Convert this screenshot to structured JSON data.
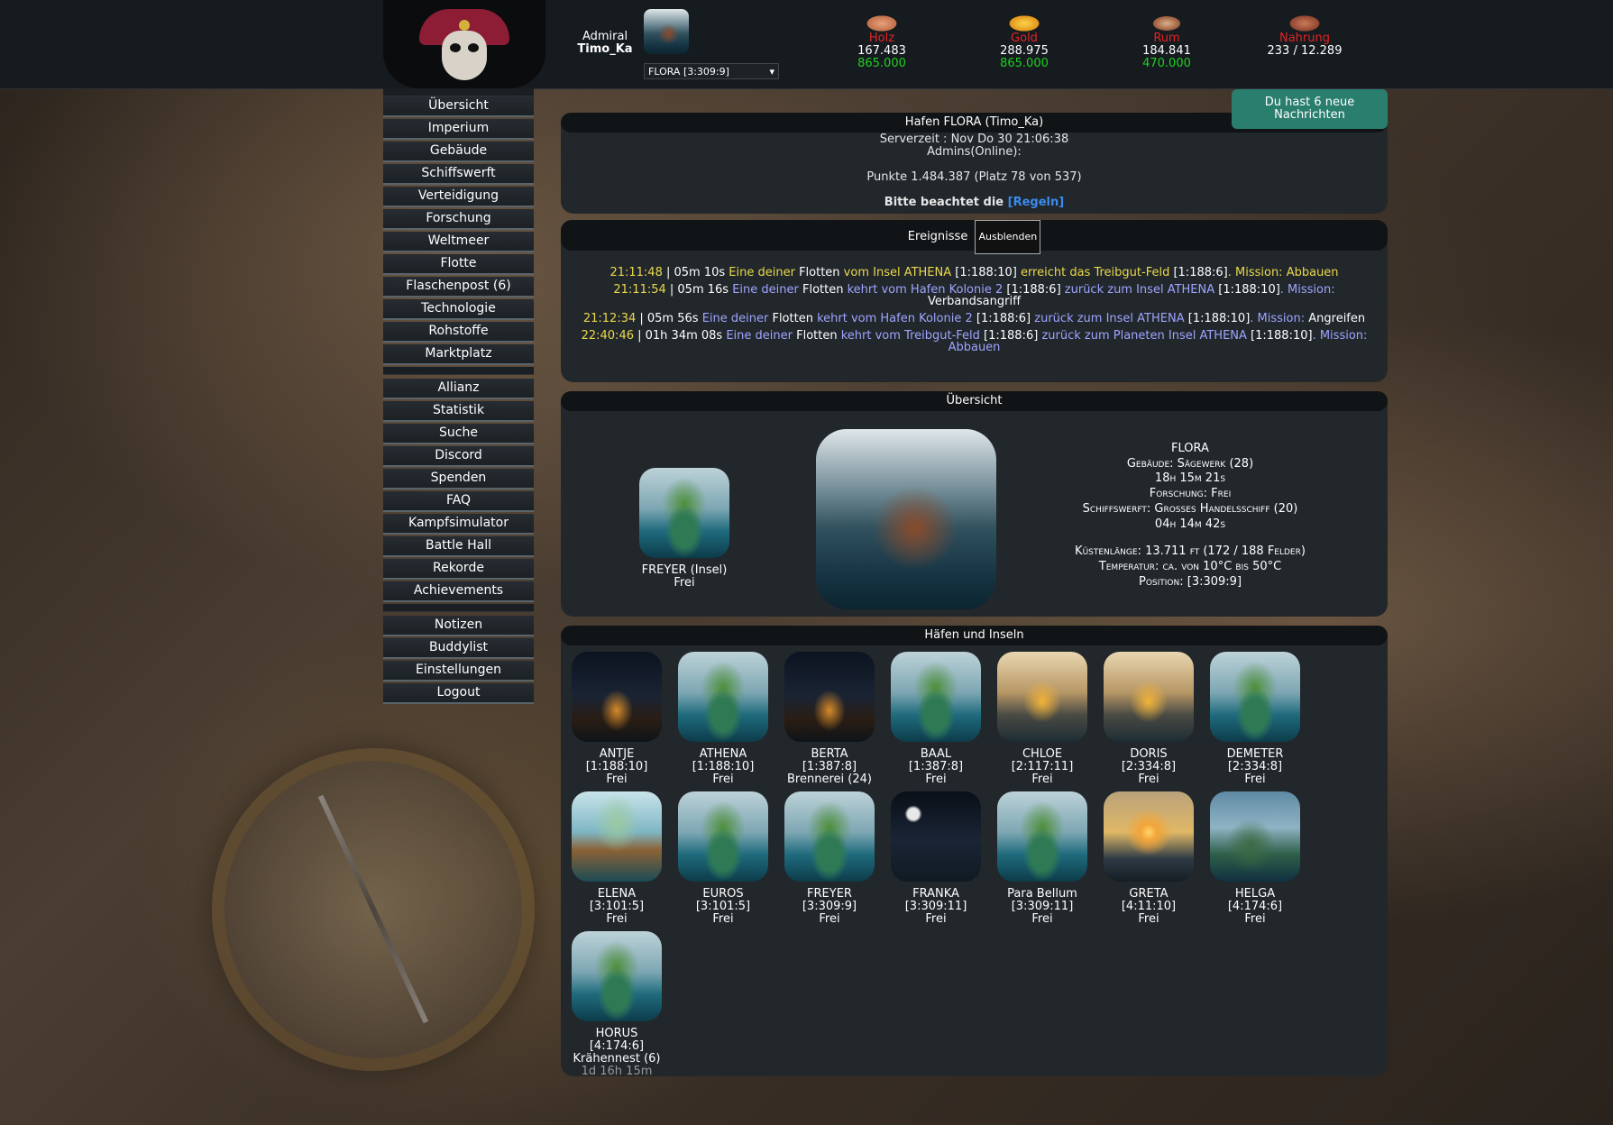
{
  "header": {
    "rank": "Admiral",
    "player": "Timo_Ka",
    "planet_select": "FLORA [3:309:9]",
    "resources": [
      {
        "name": "Holz",
        "current": "167.483",
        "max": "865.000",
        "icon": "wood-icon"
      },
      {
        "name": "Gold",
        "current": "288.975",
        "max": "865.000",
        "icon": "gold-icon"
      },
      {
        "name": "Rum",
        "current": "184.841",
        "max": "470.000",
        "icon": "rum-icon"
      },
      {
        "name": "Nahrung",
        "current": "233 / 12.289",
        "max": "",
        "icon": "food-icon"
      }
    ]
  },
  "sidebar": {
    "group1": [
      "Übersicht",
      "Imperium",
      "Gebäude",
      "Schiffswerft",
      "Verteidigung",
      "Forschung",
      "Weltmeer",
      "Flotte",
      "Flaschenpost (6)",
      "Technologie",
      "Rohstoffe",
      "Marktplatz"
    ],
    "group2": [
      "Allianz",
      "Statistik",
      "Suche",
      "Discord",
      "Spenden",
      "FAQ",
      "Kampfsimulator",
      "Battle Hall",
      "Rekorde",
      "Achievements"
    ],
    "group3": [
      "Notizen",
      "Buddylist",
      "Einstellungen",
      "Logout"
    ]
  },
  "messages": {
    "line1": "Du hast 6 neue",
    "line2": "Nachrichten"
  },
  "harbor": {
    "title": "Hafen FLORA (Timo_Ka)",
    "server_time": "Serverzeit : Nov Do 30 21:06:38",
    "admins": "Admins(Online):",
    "points": "Punkte 1.484.387 (Platz 78 von 537)",
    "rules_prefix": "Bitte beachtet die",
    "rules_link": "[Regeln]"
  },
  "events": {
    "title": "Ereignisse",
    "hide_button": "Ausblenden",
    "items": [
      {
        "time": "21:11:48",
        "dur": " | 05m 10s ",
        "a": "Eine deiner ",
        "b": "Flotten",
        "c": " vom Insel ATHENA ",
        "d": "[1:188:10]",
        "e": " erreicht das Treibgut-Feld ",
        "f": "[1:188:6]",
        "g": ". Mission: ",
        "h": "Abbauen",
        "style": "yellow"
      },
      {
        "time": "21:11:54",
        "dur": " | 05m 16s ",
        "a": "Eine deiner ",
        "b": "Flotten",
        "c": " kehrt vom Hafen Kolonie 2 ",
        "d": "[1:188:6]",
        "e": " zurück zum Insel ATHENA ",
        "f": "[1:188:10]",
        "g": ". Mission: ",
        "h": "Verbandsangriff",
        "style": "lavender"
      },
      {
        "time": "21:12:34",
        "dur": " | 05m 56s ",
        "a": "Eine deiner ",
        "b": "Flotten",
        "c": " kehrt vom Hafen Kolonie 2 ",
        "d": "[1:188:6]",
        "e": " zurück zum Insel ATHENA ",
        "f": "[1:188:10]",
        "g": ". Mission: ",
        "h": "Angreifen",
        "style": "lavender"
      },
      {
        "time": "22:40:46",
        "dur": " | 01h 34m 08s ",
        "a": "Eine deiner ",
        "b": "Flotten",
        "c": " kehrt vom Treibgut-Feld ",
        "d": "[1:188:6]",
        "e": " zurück zum Planeten Insel ATHENA ",
        "f": "[1:188:10]",
        "g": ". Mission: ",
        "h": "Abbauen",
        "style": "lavender2"
      }
    ]
  },
  "overview": {
    "title": "Übersicht",
    "moon_name": "FREYER (Insel)",
    "moon_status": "Frei",
    "info": [
      "FLORA",
      "Gebäude: Sägewerk (28)",
      "18h 15m 21s",
      "Forschung: Frei",
      "Schiffswerft: Großes Handelsschiff (20)",
      "04h 14m 42s",
      "",
      "Küstenlänge: 13.711 ft (172 / 188 Felder)",
      "Temperatur: ca. von 10°C bis 50°C",
      "Position: [3:309:9]"
    ]
  },
  "islands": {
    "title": "Häfen und Inseln",
    "items": [
      {
        "name": "ANTJE",
        "coords": "[1:188:10]",
        "status": "Frei",
        "img": "night"
      },
      {
        "name": "ATHENA",
        "coords": "[1:188:10]",
        "status": "Frei",
        "img": "isle"
      },
      {
        "name": "BERTA",
        "coords": "[1:387:8]",
        "status": "Brennerei (24)",
        "img": "night"
      },
      {
        "name": "BAAL",
        "coords": "[1:387:8]",
        "status": "Frei",
        "img": "isle"
      },
      {
        "name": "CHLOE",
        "coords": "[2:117:11]",
        "status": "Frei",
        "img": "fire"
      },
      {
        "name": "DORIS",
        "coords": "[2:334:8]",
        "status": "Frei",
        "img": "fire"
      },
      {
        "name": "DEMETER",
        "coords": "[2:334:8]",
        "status": "Frei",
        "img": "isle"
      },
      {
        "name": "ELENA",
        "coords": "[3:101:5]",
        "status": "Frei",
        "img": "beach"
      },
      {
        "name": "EUROS",
        "coords": "[3:101:5]",
        "status": "Frei",
        "img": "isle"
      },
      {
        "name": "FREYER",
        "coords": "[3:309:9]",
        "status": "Frei",
        "img": "isle"
      },
      {
        "name": "FRANKA",
        "coords": "[3:309:11]",
        "status": "Frei",
        "img": "moon"
      },
      {
        "name": "Para Bellum",
        "coords": "[3:309:11]",
        "status": "Frei",
        "img": "isle"
      },
      {
        "name": "GRETA",
        "coords": "[4:11:10]",
        "status": "Frei",
        "img": "sunset"
      },
      {
        "name": "HELGA",
        "coords": "[4:174:6]",
        "status": "Frei",
        "img": "lush"
      },
      {
        "name": "HORUS",
        "coords": "[4:174:6]",
        "status": "Krähennest (6)",
        "extra": "1d 16h 15m",
        "img": "isle"
      }
    ]
  }
}
